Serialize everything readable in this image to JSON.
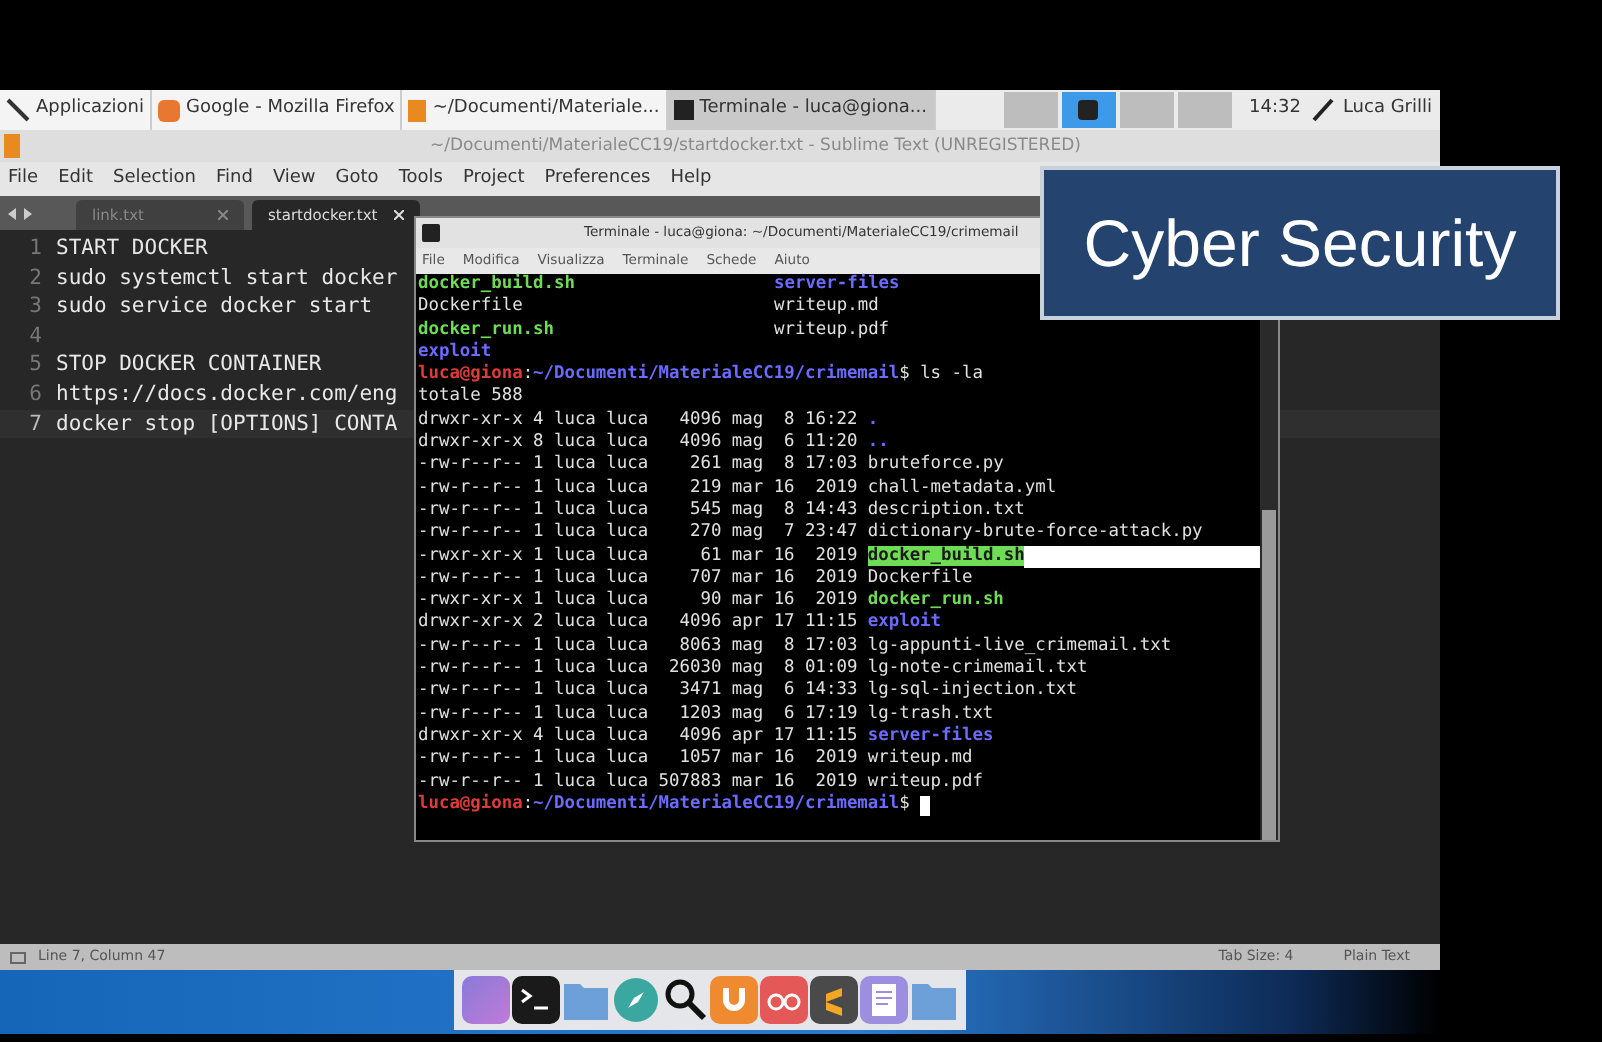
{
  "taskbar": {
    "items": [
      {
        "label": "Applicazioni",
        "selected": false
      },
      {
        "label": "Google - Mozilla Firefox",
        "selected": false
      },
      {
        "label": "~/Documenti/Materiale...",
        "selected": false
      },
      {
        "label": "Terminale - luca@giona...",
        "selected": true
      }
    ],
    "workspaces": [
      {
        "selected": false
      },
      {
        "selected": true
      },
      {
        "selected": false
      },
      {
        "selected": false
      }
    ],
    "clock": "14:32",
    "user": "Luca Grilli"
  },
  "editor": {
    "title": "~/Documenti/MaterialeCC19/startdocker.txt - Sublime Text (UNREGISTERED)",
    "menu": [
      "File",
      "Edit",
      "Selection",
      "Find",
      "View",
      "Goto",
      "Tools",
      "Project",
      "Preferences",
      "Help"
    ],
    "tabs": [
      {
        "label": "link.txt",
        "selected": false
      },
      {
        "label": "startdocker.txt",
        "selected": true
      }
    ],
    "lines": [
      {
        "number": "1",
        "text": "START DOCKER",
        "current": false
      },
      {
        "number": "2",
        "text": "sudo systemctl start docker",
        "current": false
      },
      {
        "number": "3",
        "text": "sudo service docker start",
        "current": false
      },
      {
        "number": "4",
        "current": false
      },
      {
        "number": "5",
        "text": "STOP DOCKER CONTAINER",
        "current": false
      },
      {
        "number": "6",
        "text": "https://docs.docker.com/eng",
        "current": false
      },
      {
        "number": "7",
        "text": "docker stop [OPTIONS] CONTA",
        "current": true
      }
    ],
    "status_bar": {
      "position": "Line 7, Column 47",
      "tab_size": "Tab Size: 4",
      "syntax": "Plain Text"
    }
  },
  "terminal": {
    "title": "Terminale - luca@giona: ~/Documenti/MaterialeCC19/crimemail",
    "menu": [
      "File",
      "Modifica",
      "Visualizza",
      "Terminale",
      "Schede",
      "Aiuto"
    ],
    "cursor_visible": true,
    "lines": [
      {
        "left": [
          {
            "text": "docker_build.sh",
            "kind": "exec"
          }
        ],
        "right": [
          {
            "text": "server-files",
            "kind": "dir"
          }
        ]
      },
      {
        "left": [
          {
            "text": "Dockerfile",
            "kind": "plain"
          }
        ],
        "right": [
          {
            "text": "writeup.md",
            "kind": "plain"
          }
        ]
      },
      {
        "left": [
          {
            "text": "docker_run.sh",
            "kind": "exec"
          }
        ],
        "right": [
          {
            "text": "writeup.pdf",
            "kind": "plain"
          }
        ]
      },
      {
        "left": [
          {
            "text": "exploit",
            "kind": "dir"
          }
        ]
      },
      {
        "left": [
          {
            "text": "luca@giona",
            "kind": "user"
          },
          {
            "text": ":",
            "kind": "plain"
          },
          {
            "text": "~/Documenti/MaterialeCC19/crimemail",
            "kind": "path"
          },
          {
            "text": "$ ls -la",
            "kind": "plain"
          }
        ]
      },
      {
        "left": [
          {
            "text": "totale 588",
            "kind": "plain"
          }
        ]
      },
      {
        "left": [
          {
            "text": "drwxr-xr-x 4 luca luca   4096 mag  8 16:22 ",
            "kind": "plain"
          },
          {
            "text": ".",
            "kind": "dir"
          }
        ]
      },
      {
        "left": [
          {
            "text": "drwxr-xr-x 8 luca luca   4096 mag  6 11:20 ",
            "kind": "plain"
          },
          {
            "text": "..",
            "kind": "dir"
          }
        ]
      },
      {
        "left": [
          {
            "text": "-rw-r--r-- 1 luca luca    261 mag  8 17:03 bruteforce.py",
            "kind": "plain"
          }
        ]
      },
      {
        "left": [
          {
            "text": "-rw-r--r-- 1 luca luca    219 mar 16  2019 chall-metadata.yml",
            "kind": "plain"
          }
        ]
      },
      {
        "left": [
          {
            "text": "-rw-r--r-- 1 luca luca    545 mag  8 14:43 description.txt",
            "kind": "plain"
          }
        ]
      },
      {
        "left": [
          {
            "text": "-rw-r--r-- 1 luca luca    270 mag  7 23:47 dictionary-brute-force-attack.py",
            "kind": "plain"
          }
        ]
      },
      {
        "left": [
          {
            "text": "-rwxr-xr-x 1 luca luca     61 mar 16  2019 ",
            "kind": "plain"
          },
          {
            "text": "docker_build.sh",
            "kind": "selected-exec"
          }
        ]
      },
      {
        "left": [
          {
            "text": "-rw-r--r-- 1 luca luca    707 mar 16  2019 Dockerfile",
            "kind": "plain"
          }
        ]
      },
      {
        "left": [
          {
            "text": "-rwxr-xr-x 1 luca luca     90 mar 16  2019 ",
            "kind": "plain"
          },
          {
            "text": "docker_run.sh",
            "kind": "exec"
          }
        ]
      },
      {
        "left": [
          {
            "text": "drwxr-xr-x 2 luca luca   4096 apr 17 11:15 ",
            "kind": "plain"
          },
          {
            "text": "exploit",
            "kind": "dir"
          }
        ]
      },
      {
        "left": [
          {
            "text": "-rw-r--r-- 1 luca luca   8063 mag  8 17:03 lg-appunti-live_crimemail.txt",
            "kind": "plain"
          }
        ]
      },
      {
        "left": [
          {
            "text": "-rw-r--r-- 1 luca luca  26030 mag  8 01:09 lg-note-crimemail.txt",
            "kind": "plain"
          }
        ]
      },
      {
        "left": [
          {
            "text": "-rw-r--r-- 1 luca luca   3471 mag  6 14:33 lg-sql-injection.txt",
            "kind": "plain"
          }
        ]
      },
      {
        "left": [
          {
            "text": "-rw-r--r-- 1 luca luca   1203 mag  6 17:19 lg-trash.txt",
            "kind": "plain"
          }
        ]
      },
      {
        "left": [
          {
            "text": "drwxr-xr-x 4 luca luca   4096 apr 17 11:15 ",
            "kind": "plain"
          },
          {
            "text": "server-files",
            "kind": "dir"
          }
        ]
      },
      {
        "left": [
          {
            "text": "-rw-r--r-- 1 luca luca   1057 mar 16  2019 writeup.md",
            "kind": "plain"
          }
        ]
      },
      {
        "left": [
          {
            "text": "-rw-r--r-- 1 luca luca 507883 mar 16  2019 writeup.pdf",
            "kind": "plain"
          }
        ]
      },
      {
        "left": [
          {
            "text": "luca@giona",
            "kind": "user"
          },
          {
            "text": ":",
            "kind": "plain"
          },
          {
            "text": "~/Documenti/MaterialeCC19/crimemail",
            "kind": "path"
          },
          {
            "text": "$ ",
            "kind": "plain"
          }
        ]
      }
    ]
  },
  "overlay": {
    "caption": "Cyber Security"
  }
}
